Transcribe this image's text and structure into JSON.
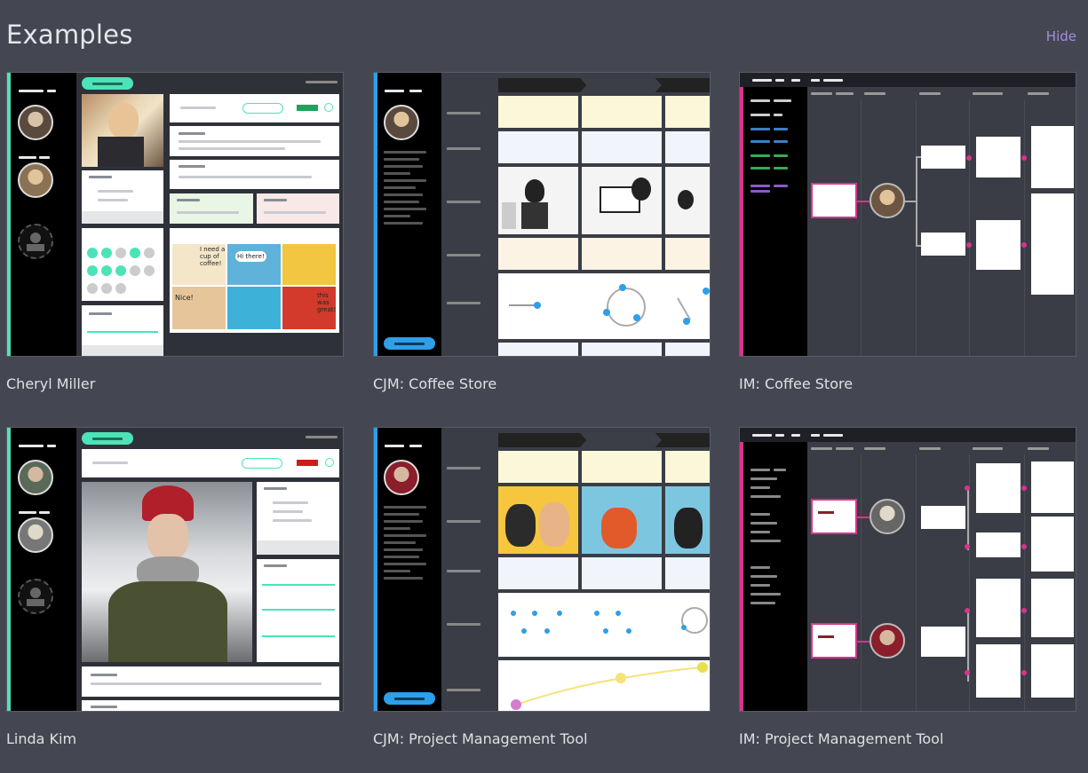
{
  "header": {
    "title": "Examples",
    "hide_label": "Hide"
  },
  "colors": {
    "background": "#444751",
    "accent_teal": "#4de3b8",
    "accent_blue": "#2e9fe8",
    "accent_pink": "#d8348c",
    "link_purple": "#a68ce0"
  },
  "cards": [
    {
      "label": "Cheryl Miller",
      "kind": "persona"
    },
    {
      "label": "CJM: Coffee Store",
      "kind": "journey-map"
    },
    {
      "label": "IM: Coffee Store",
      "kind": "impact-map"
    },
    {
      "label": "Linda Kim",
      "kind": "persona"
    },
    {
      "label": "CJM: Project Management Tool",
      "kind": "journey-map"
    },
    {
      "label": "IM: Project Management Tool",
      "kind": "impact-map"
    }
  ],
  "comic_text": {
    "bubble_1": "I need a cup of coffee!",
    "bubble_2": "Hi there!",
    "bubble_3": "Nice!",
    "bubble_4": "this was great!"
  }
}
